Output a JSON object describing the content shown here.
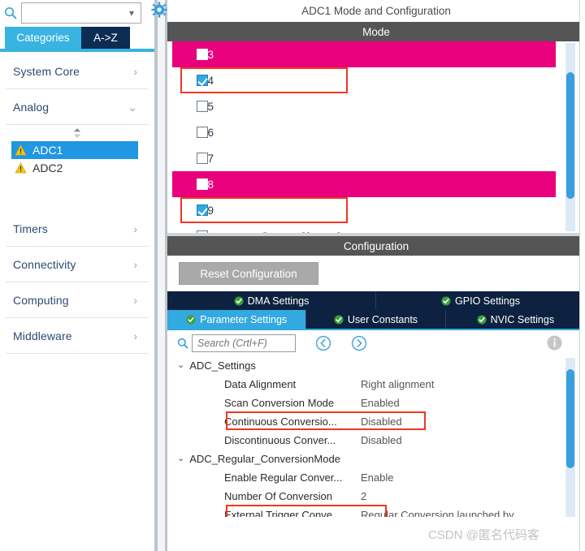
{
  "sidebar": {
    "search": {
      "value": "",
      "placeholder": ""
    },
    "tabs": [
      {
        "label": "Categories",
        "active": true
      },
      {
        "label": "A->Z",
        "active": false
      }
    ],
    "groups": [
      {
        "label": "System Core",
        "expanded": false,
        "arrow": "chevron-right"
      },
      {
        "label": "Analog",
        "expanded": true,
        "arrow": "chevron-down"
      },
      {
        "label": "Timers",
        "expanded": false,
        "arrow": "chevron-right"
      },
      {
        "label": "Connectivity",
        "expanded": false,
        "arrow": "chevron-right"
      },
      {
        "label": "Computing",
        "expanded": false,
        "arrow": "chevron-right"
      },
      {
        "label": "Middleware",
        "expanded": false,
        "arrow": "chevron-right"
      }
    ],
    "analog_items": [
      {
        "label": "ADC1",
        "selected": true,
        "icon": "warning-icon"
      },
      {
        "label": "ADC2",
        "selected": false,
        "icon": "warning-icon"
      }
    ]
  },
  "panel": {
    "title": "ADC1 Mode and Configuration",
    "mode_header": "Mode",
    "config_header": "Configuration",
    "reset_button": "Reset Configuration"
  },
  "mode": {
    "channels": [
      {
        "label": "IN3",
        "checked": false,
        "highlight": "pink"
      },
      {
        "label": "IN4",
        "checked": true,
        "highlight": "none",
        "outlined": true
      },
      {
        "label": "IN5",
        "checked": false,
        "highlight": "none"
      },
      {
        "label": "IN6",
        "checked": false,
        "highlight": "none"
      },
      {
        "label": "IN7",
        "checked": false,
        "highlight": "none"
      },
      {
        "label": "IN8",
        "checked": false,
        "highlight": "pink"
      },
      {
        "label": "IN9",
        "checked": true,
        "highlight": "none",
        "outlined": true
      },
      {
        "label": "Temperature Sensor Channel",
        "checked": false,
        "highlight": "none"
      }
    ]
  },
  "config": {
    "tabs_row1": [
      {
        "label": "DMA Settings",
        "active": false,
        "icon": "check-circle-icon"
      },
      {
        "label": "GPIO Settings",
        "active": false,
        "icon": "check-circle-icon"
      }
    ],
    "tabs_row2": [
      {
        "label": "Parameter Settings",
        "active": true,
        "icon": "check-circle-icon"
      },
      {
        "label": "User Constants",
        "active": false,
        "icon": "check-circle-icon"
      },
      {
        "label": "NVIC Settings",
        "active": false,
        "icon": "check-circle-icon"
      }
    ],
    "search": {
      "value": "",
      "placeholder": "Search (Crtl+F)"
    },
    "nav_prev": "prev-icon",
    "nav_next": "next-icon",
    "info": "info-icon",
    "groups": [
      {
        "label": "ADC_Settings",
        "expanded": true,
        "rows": [
          {
            "key": "Data Alignment",
            "value": "Right alignment",
            "outlined": false
          },
          {
            "key": "Scan Conversion Mode",
            "value": "Enabled",
            "outlined": false
          },
          {
            "key": "Continuous Conversio...",
            "value": "Disabled",
            "outlined": true
          },
          {
            "key": "Discontinuous Conver...",
            "value": "Disabled",
            "outlined": false
          }
        ]
      },
      {
        "label": "ADC_Regular_ConversionMode",
        "expanded": true,
        "rows": [
          {
            "key": "Enable Regular Conver...",
            "value": "Enable",
            "outlined": false
          },
          {
            "key": "Number Of Conversion",
            "value": "2",
            "outlined": true
          },
          {
            "key": "External Trigger Conve...",
            "value": "Regular Conversion launched by ...",
            "outlined": false
          }
        ]
      }
    ]
  },
  "watermark": "CSDN @匿名代码客",
  "colors": {
    "accent_blue": "#33a9e0",
    "tab_navy": "#0d2240",
    "pink_highlight": "#e8007d",
    "red_outline": "#f0371d",
    "header_gray": "#555555",
    "warning_yellow": "#f5c518"
  }
}
